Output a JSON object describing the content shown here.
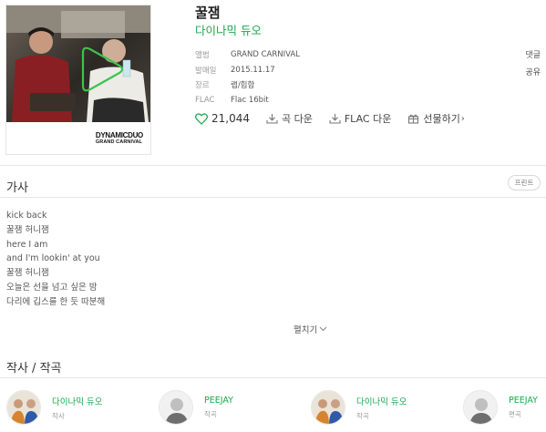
{
  "song": {
    "title": "꿀잼",
    "artist": "다이나믹 듀오"
  },
  "album_cover": {
    "brand_line1": "DYNAMICDUO",
    "brand_line2": "GRAND CARNIVAL"
  },
  "meta": [
    {
      "key": "앨범",
      "value": "GRAND CARNIVAL"
    },
    {
      "key": "발매일",
      "value": "2015.11.17"
    },
    {
      "key": "장르",
      "value": "랩/힙합"
    },
    {
      "key": "FLAC",
      "value": "Flac 16bit"
    }
  ],
  "side_links": {
    "comment": "댓글",
    "share": "공유"
  },
  "actions": {
    "like_count": "21,044",
    "download": "곡 다운",
    "flac_download": "FLAC 다운",
    "gift": "선물하기"
  },
  "lyrics": {
    "section_title": "가사",
    "print_label": "프린트",
    "lines": [
      "kick back",
      "꿀잼 허니잼",
      "here I am",
      "and I'm lookin' at you",
      "꿀잼 허니잼",
      "오늘은 선을 넘고 싶은 밤",
      "다리에 깁스를 한 듯 따분해"
    ],
    "expand_label": "펼치기"
  },
  "credits": {
    "section_title": "작사 / 작곡",
    "people": [
      {
        "name": "다이나믹 듀오",
        "role": "작사"
      },
      {
        "name": "PEEJAY",
        "role": "작곡"
      },
      {
        "name": "다이나믹 듀오",
        "role": "작곡"
      },
      {
        "name": "PEEJAY",
        "role": "편곡"
      }
    ]
  },
  "colors": {
    "accent_green": "#1aa84a",
    "text_dark": "#333333",
    "text_muted": "#999999",
    "divider": "#e6e6e6"
  },
  "icons": {
    "like": "heart-outline-icon",
    "download": "download-icon",
    "gift": "gift-icon",
    "expand": "chevron-down-icon",
    "play_overlay": "play-outline-icon"
  }
}
